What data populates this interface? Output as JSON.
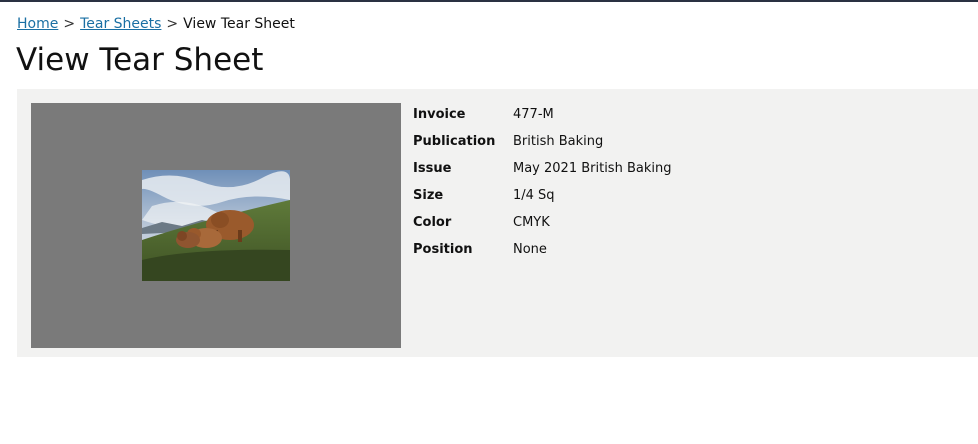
{
  "breadcrumb": {
    "home": "Home",
    "sep1": ">",
    "tear_sheets": "Tear Sheets",
    "sep2": ">",
    "current": "View Tear Sheet"
  },
  "page": {
    "title": "View Tear Sheet"
  },
  "details": [
    {
      "label": "Invoice",
      "value": "477-M"
    },
    {
      "label": "Publication",
      "value": "British Baking"
    },
    {
      "label": "Issue",
      "value": "May 2021 British Baking"
    },
    {
      "label": "Size",
      "value": "1/4 Sq"
    },
    {
      "label": "Color",
      "value": "CMYK"
    },
    {
      "label": "Position",
      "value": "None"
    }
  ],
  "colors": {
    "link": "#1a6fa3",
    "panel": "#f2f2f1",
    "image_frame": "#7a7a7a"
  }
}
